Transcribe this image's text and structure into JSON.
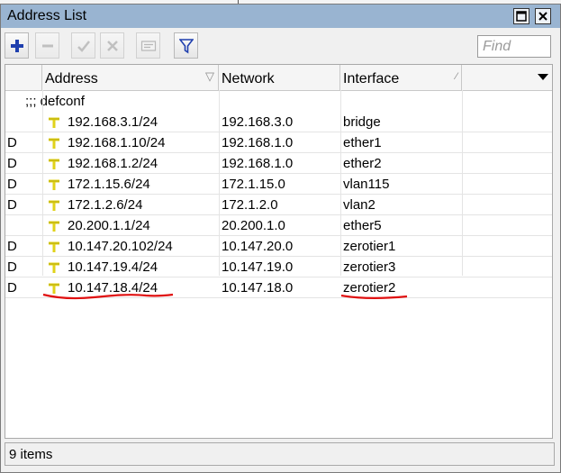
{
  "window": {
    "title": "Address List",
    "controls": [
      "maximize",
      "close"
    ]
  },
  "toolbar": {
    "buttons": [
      {
        "name": "add",
        "icon": "plus-icon",
        "enabled": true
      },
      {
        "name": "remove",
        "icon": "minus-icon",
        "enabled": false
      },
      {
        "name": "enable",
        "icon": "check-icon",
        "enabled": false
      },
      {
        "name": "disable",
        "icon": "x-icon",
        "enabled": false
      },
      {
        "name": "comment",
        "icon": "comment-icon",
        "enabled": false
      },
      {
        "name": "filter",
        "icon": "filter-icon",
        "enabled": true
      }
    ],
    "find_placeholder": "Find"
  },
  "table": {
    "columns": [
      "",
      "Address",
      "Network",
      "Interface"
    ],
    "comment": ";;; defconf",
    "rows": [
      {
        "flag": "",
        "address": "192.168.3.1/24",
        "network": "192.168.3.0",
        "interface": "bridge"
      },
      {
        "flag": "D",
        "address": "192.168.1.10/24",
        "network": "192.168.1.0",
        "interface": "ether1"
      },
      {
        "flag": "D",
        "address": "192.168.1.2/24",
        "network": "192.168.1.0",
        "interface": "ether2"
      },
      {
        "flag": "D",
        "address": "172.1.15.6/24",
        "network": "172.1.15.0",
        "interface": "vlan115"
      },
      {
        "flag": "D",
        "address": "172.1.2.6/24",
        "network": "172.1.2.0",
        "interface": "vlan2"
      },
      {
        "flag": "",
        "address": "20.200.1.1/24",
        "network": "20.200.1.0",
        "interface": "ether5"
      },
      {
        "flag": "D",
        "address": "10.147.20.102/24",
        "network": "10.147.20.0",
        "interface": "zerotier1"
      },
      {
        "flag": "D",
        "address": "10.147.19.4/24",
        "network": "10.147.19.0",
        "interface": "zerotier3"
      },
      {
        "flag": "D",
        "address": "10.147.18.4/24",
        "network": "10.147.18.0",
        "interface": "zerotier2"
      }
    ]
  },
  "status": {
    "text": "9 items"
  },
  "colors": {
    "titlebar": "#99b4d1",
    "add_icon": "#1f3fae",
    "filter_icon": "#1f3fae",
    "address_pin": "#e0d21a",
    "annotation": "#e01010"
  }
}
